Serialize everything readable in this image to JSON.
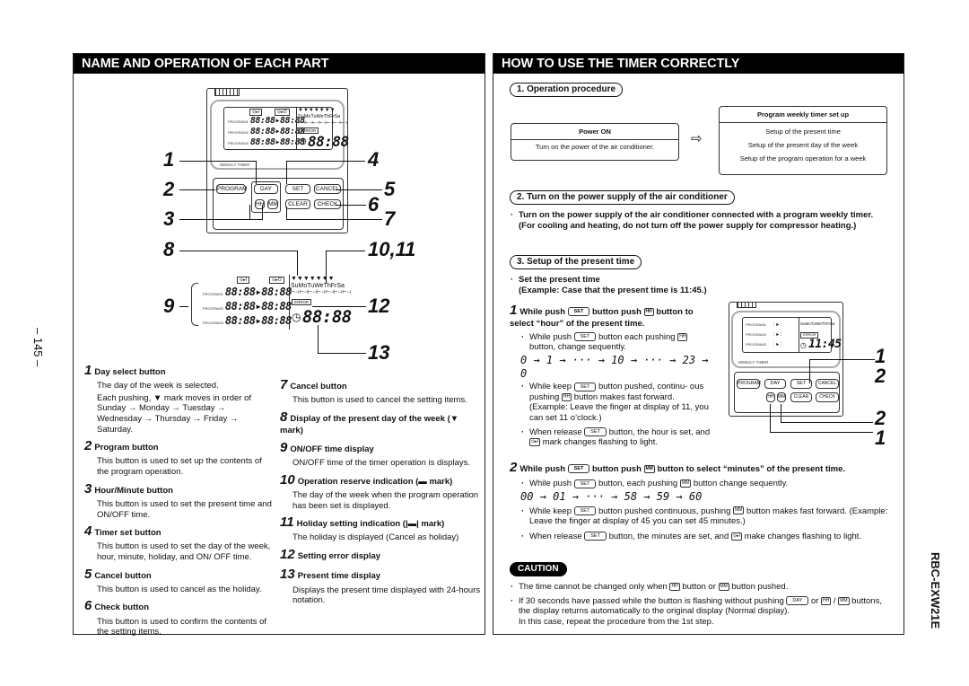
{
  "page_number": "– 145 –",
  "model": "RBC-EXW21E",
  "left": {
    "title": "NAME AND OPERATION OF EACH PART",
    "remote": {
      "weekly_label": "WEEKLY TIMER",
      "on_mark": "⊙▸I",
      "off_mark": "⊙▸O",
      "programs": [
        "PROGRAM1",
        "PROGRAM2",
        "PROGRAM3"
      ],
      "prog_time": "88:88▸88:88",
      "days": "SuMoTuWeThFrSa",
      "holiday_marks": "⊢⊣⊢⊣⊢⊣⊢⊣⊢⊣⊢⊣⊢⊣",
      "error": "ERROR",
      "clock_time": "88:88",
      "keys": {
        "program": "PROGRAM",
        "day": "DAY",
        "set": "SET",
        "cancel": "CANCEL",
        "hh": "HH",
        "mm": "MM",
        "clear": "CLEAR",
        "check": "CHECK"
      }
    },
    "callouts": [
      "1",
      "2",
      "3",
      "4",
      "5",
      "6",
      "7",
      "8",
      "10,11",
      "9",
      "12",
      "13"
    ],
    "items_col1": [
      {
        "n": "1",
        "title": "Day select button",
        "body": [
          "The day of the week is selected.",
          "Each pushing, ▼ mark moves in order of Sunday → Monday → Tuesday → Wednesday → Thursday → Friday → Saturday."
        ]
      },
      {
        "n": "2",
        "title": "Program button",
        "body": [
          "This button is used to set up the contents of the program operation."
        ]
      },
      {
        "n": "3",
        "title": "Hour/Minute button",
        "body": [
          "This button is used to set the present time and ON/OFF time."
        ]
      },
      {
        "n": "4",
        "title": "Timer set button",
        "body": [
          "This button is used to set the day of the week, hour, minute, holiday, and ON/ OFF time."
        ]
      },
      {
        "n": "5",
        "title": "Cancel button",
        "body": [
          "This button is used to cancel as the holiday."
        ]
      },
      {
        "n": "6",
        "title": "Check button",
        "body": [
          "This button is used to confirm the contents of the setting items."
        ]
      }
    ],
    "items_col2": [
      {
        "n": "7",
        "title": "Cancel button",
        "body": [
          "This button is used to cancel the setting items."
        ]
      },
      {
        "n": "8",
        "title": "Display of the present day of the week (▼ mark)",
        "body": []
      },
      {
        "n": "9",
        "title": "ON/OFF time display",
        "body": [
          "ON/OFF time of the timer operation is displays."
        ]
      },
      {
        "n": "10",
        "title": "Operation reserve indication (▬ mark)",
        "body": [
          "The day of the week when the program operation has been set is displayed."
        ]
      },
      {
        "n": "11",
        "title": "Holiday setting indication (|▬| mark)",
        "body": [
          "The holiday is displayed (Cancel as holiday)"
        ]
      },
      {
        "n": "12",
        "title": "Setting error display",
        "body": []
      },
      {
        "n": "13",
        "title": "Present time display",
        "body": [
          "Displays the present time displayed with 24-hours notation."
        ]
      }
    ]
  },
  "right": {
    "title": "HOW TO USE THE TIMER CORRECTLY",
    "s1": {
      "heading": "1. Operation procedure",
      "power_title": "Power ON",
      "power_text": "Turn on the power of the air conditioner.",
      "arrow": "⇨",
      "setup_title": "Program weekly timer set up",
      "setup_lines": [
        "Setup of the present time",
        "Setup of the present day of the week",
        "Setup of the program operation for a week"
      ]
    },
    "s2": {
      "heading": "2. Turn on the power supply of the air conditioner",
      "text": "Turn on the power supply of the air conditioner connected with a program weekly timer. (For cooling and heating, do not turn off the power supply for compressor heating.)"
    },
    "s3": {
      "heading": "3. Setup of the present time",
      "intro1": "Set the present time",
      "intro2": "(Example: Case that the present time is 11:45.)",
      "step1": {
        "n": "1",
        "a": "While push",
        "b": "button push",
        "c": "button to select “hour” of the present time.",
        "b1a": "While push",
        "b1b": "button each pushing",
        "b1c": "button, change sequently.",
        "seq": "0 → 1 → ··· → 10 → ··· → 23 → 0",
        "b2a": "While keep",
        "b2b": "button pushed, continu- ous pushing",
        "b2c": "button makes fast forward. (Example: Leave the finger at display of 11, you can set 11 o’clock.)",
        "b3a": "When release",
        "b3b": "button, the hour is set, and",
        "b3c": "mark changes flashing to light."
      },
      "step2": {
        "n": "2",
        "a": "While push",
        "b": "button push",
        "c": "button to select “minutes” of the present time.",
        "b1a": "While push",
        "b1b": "button, each pushing",
        "b1c": "button change sequently.",
        "seq": "00 → 01 → ··· → 58 → 59 → 60",
        "b2a": "While keep",
        "b2b": "button pushed continuous, pushing",
        "b2c": "button makes fast forward. (Example: Leave the finger at display of 45 you can set 45 minutes.)",
        "b3a": "When release",
        "b3b": "button, the minutes are set, and",
        "b3c": "make changes flashing to light."
      },
      "small_remote_time": "11:45",
      "small_callouts": [
        "1",
        "2",
        "2",
        "1"
      ]
    },
    "caution": {
      "label": "CAUTION",
      "c1a": "The time cannot be changed only when",
      "c1b": "button or",
      "c1c": "button pushed.",
      "c2a": "If 30 seconds have passed while the button is flashing without pushing",
      "c2b": "or",
      "c2c": "/",
      "c2d": "buttons, the display returns automatically to the original display (Normal display).",
      "c2e": "In this case, repeat the procedure from the 1st step."
    }
  }
}
